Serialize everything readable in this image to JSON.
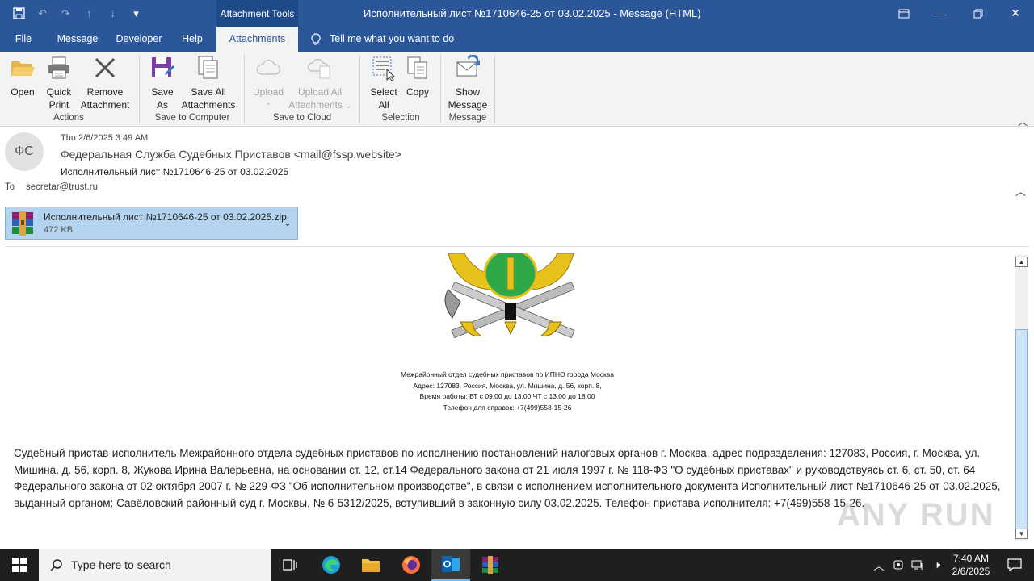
{
  "window": {
    "context_tab_group": "Attachment Tools",
    "title": "Исполнительный лист №1710646-25 от 03.02.2025  -  Message (HTML)",
    "controls": [
      "restore-ribbon",
      "minimize",
      "maximize",
      "close"
    ]
  },
  "tabs": {
    "file": "File",
    "message": "Message",
    "developer": "Developer",
    "help": "Help",
    "attachments": "Attachments",
    "tell_me": "Tell me what you want to do"
  },
  "ribbon": {
    "open": "Open",
    "quick_print_1": "Quick",
    "quick_print_2": "Print",
    "remove_1": "Remove",
    "remove_2": "Attachment",
    "save_as_1": "Save",
    "save_as_2": "As",
    "save_all_1": "Save All",
    "save_all_2": "Attachments",
    "upload": "Upload",
    "upload_all_1": "Upload All",
    "upload_all_2": "Attachments",
    "select_all_1": "Select",
    "select_all_2": "All",
    "copy": "Copy",
    "show_message_1": "Show",
    "show_message_2": "Message",
    "groups": {
      "actions": "Actions",
      "save_to_computer": "Save to Computer",
      "save_to_cloud": "Save to Cloud",
      "selection": "Selection",
      "message": "Message"
    }
  },
  "header": {
    "avatar_initials": "ФС",
    "date": "Thu 2/6/2025 3:49 AM",
    "from": "Федеральная Служба Судебных Приставов <mail@fssp.website>",
    "subject": "Исполнительный лист №1710646-25 от 03.02.2025",
    "to_label": "To",
    "to": "secretar@trust.ru"
  },
  "attachment": {
    "name": "Исполнительный лист №1710646-25 от 03.02.2025.zip",
    "size": "472 KB"
  },
  "body": {
    "org_line_1": "Межрайонный отдел судебных приставов по ИПНО города Москва",
    "org_line_2": "Адрес: 127083, Россия, Москва, ул. Мишина, д. 56, корп. 8,",
    "org_line_3": "Время работы: ВТ с 09.00 до 13.00 ЧТ с 13.00 до 18.00",
    "org_line_4": "Телефон для справок: +7(499)558-15-26",
    "paragraph": "Судебный пристав-исполнитель Межрайонного отдела судебных приставов по исполнению постановлений налоговых органов г. Москва, адрес подразделения: 127083, Россия, г. Москва, ул. Мишина, д. 56, корп. 8, Жукова Ирина Валерьевна, на основании ст. 12, ст.14 Федерального закона от 21 июля 1997 г. № 118-ФЗ \"О судебных приставах\" и руководствуясь ст. 6, ст. 50, ст. 64 Федерального закона от 02 октября 2007 г. № 229-ФЗ \"Об исполнительном производстве\", в связи с исполнением исполнительного документа Исполнительный лист №1710646-25 от 03.02.2025, выданный органом: Савёловский районный суд г. Москвы, № 6-5312/2025, вступивший в законную силу 03.02.2025. Телефон пристава-исполнителя: +7(499)558-15-26.",
    "watermark": "ANY RUN"
  },
  "taskbar": {
    "search_placeholder": "Type here to search",
    "time": "7:40 AM",
    "date": "2/6/2025"
  },
  "colors": {
    "accent": "#2b579a",
    "attachment_bg": "#b3d3ef",
    "taskbar": "#1f1f1f"
  }
}
